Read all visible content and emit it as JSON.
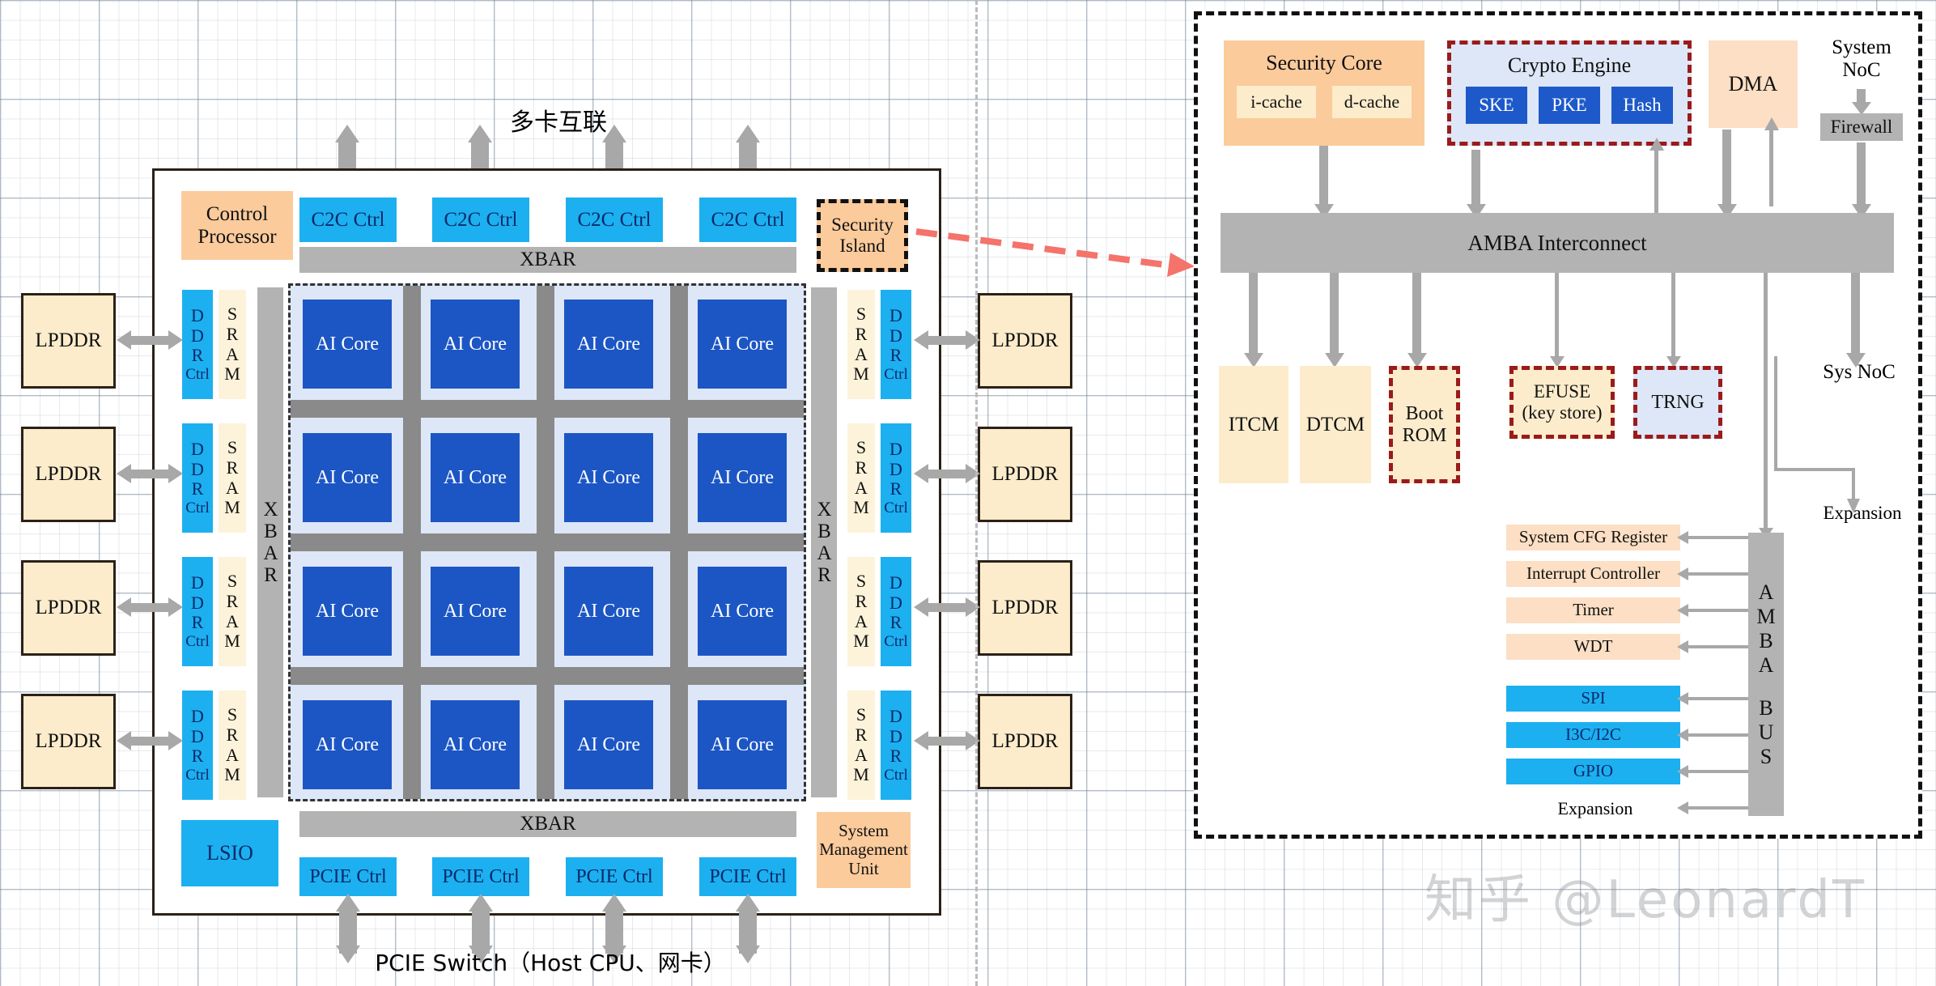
{
  "diagram": {
    "title_top_cn": "多卡互联",
    "bottom_label": "PCIE Switch（Host CPU、网卡）",
    "watermark": "知乎 @LeonardT"
  },
  "chip": {
    "control_processor": "Control\nProcessor",
    "control_processor_line1": "Control",
    "control_processor_line2": "Processor",
    "c2c_ctrl": [
      "C2C Ctrl",
      "C2C Ctrl",
      "C2C Ctrl",
      "C2C Ctrl"
    ],
    "security_island_line1": "Security",
    "security_island_line2": "Island",
    "xbar_top": "XBAR",
    "xbar_bottom": "XBAR",
    "xbar_left_vertical": "XBAR",
    "xbar_right_vertical": "XBAR",
    "ai_core_label": "AI Core",
    "ai_core_rows": 4,
    "ai_core_cols": 4,
    "ddr_ctrl_label": "DDR Ctrl",
    "ddr_ctrl_lines": [
      "D",
      "D",
      "R",
      "Ctrl"
    ],
    "sram_label": "SRAM",
    "sram_lines": [
      "S",
      "R",
      "A",
      "M"
    ],
    "lpddr_label": "LPDDR",
    "lpddr_left_count": 4,
    "lpddr_right_count": 4,
    "lsio": "LSIO",
    "pcie_ctrl": [
      "PCIE Ctrl",
      "PCIE Ctrl",
      "PCIE Ctrl",
      "PCIE Ctrl"
    ],
    "smu_line1": "System",
    "smu_line2": "Management",
    "smu_line3": "Unit"
  },
  "security_island_detail": {
    "security_core": "Security Core",
    "i_cache": "i-cache",
    "d_cache": "d-cache",
    "crypto_engine": "Crypto Engine",
    "crypto_blocks": [
      "SKE",
      "PKE",
      "Hash"
    ],
    "dma": "DMA",
    "system_noc_line1": "System",
    "system_noc_line2": "NoC",
    "firewall": "Firewall",
    "amba_interconnect": "AMBA Interconnect",
    "itcm": "ITCM",
    "dtcm": "DTCM",
    "boot_rom_line1": "Boot",
    "boot_rom_line2": "ROM",
    "efuse_line1": "EFUSE",
    "efuse_line2": "(key store)",
    "trng": "TRNG",
    "sys_noc": "Sys NoC",
    "expansion_right": "Expansion",
    "amba_bus_lines": [
      "A",
      "M",
      "B",
      "A",
      "B",
      "U",
      "S"
    ],
    "peripherals_peach": [
      "System CFG Register",
      "Interrupt Controller",
      "Timer",
      "WDT"
    ],
    "peripherals_cyan": [
      "SPI",
      "I3C/I2C",
      "GPIO"
    ],
    "expansion_bottom": "Expansion"
  },
  "colors": {
    "cyan": "#1cb0f0",
    "blue": "#1c56c4",
    "gray": "#b3b3b3",
    "peach": "#fbcb9c",
    "cream": "#fceccb",
    "light_blue": "#dee7f7",
    "dashed_red": "#9a1b1b",
    "arrow_gray": "#a8a8a8",
    "accent_red_arrow": "#f4736b"
  }
}
